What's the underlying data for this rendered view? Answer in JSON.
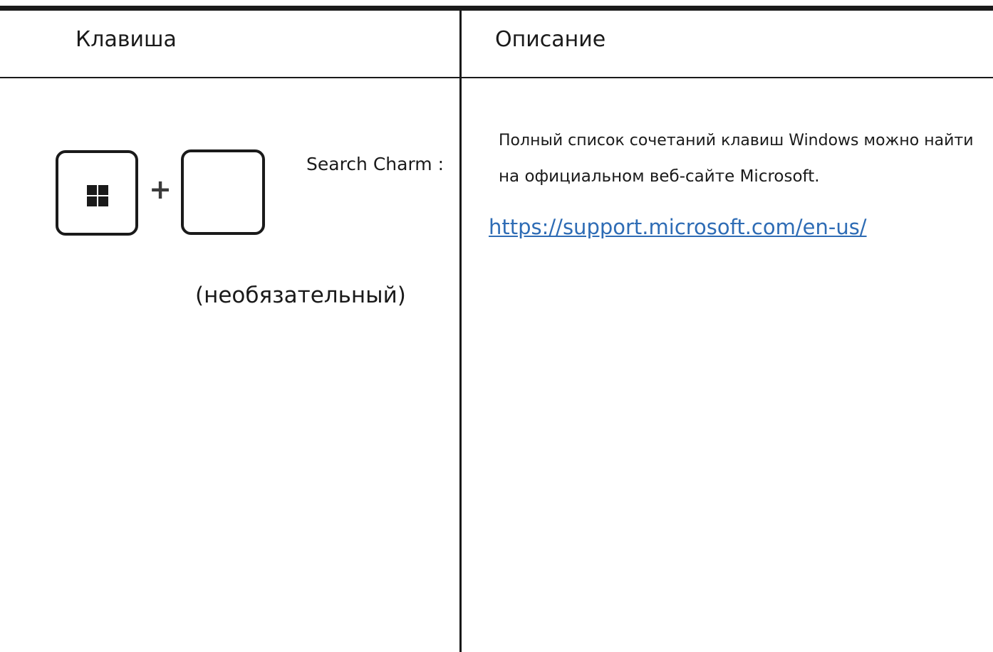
{
  "table": {
    "headers": {
      "key": "Клавиша",
      "description": "Описание"
    },
    "row": {
      "shortcut": {
        "modifier_icon": "windows-logo-icon",
        "plus": "+",
        "action": "Search Charm :",
        "note": "(необязательный)"
      },
      "description": {
        "line1": "Полный список сочетаний клавиш Windows можно найти",
        "line2": "на официальном веб-сайте Microsoft.",
        "link": "https://support.microsoft.com/en-us/"
      }
    }
  },
  "colors": {
    "rule": "#1a1a1a",
    "link": "#2e6cb5",
    "text": "#1a1a1a"
  }
}
